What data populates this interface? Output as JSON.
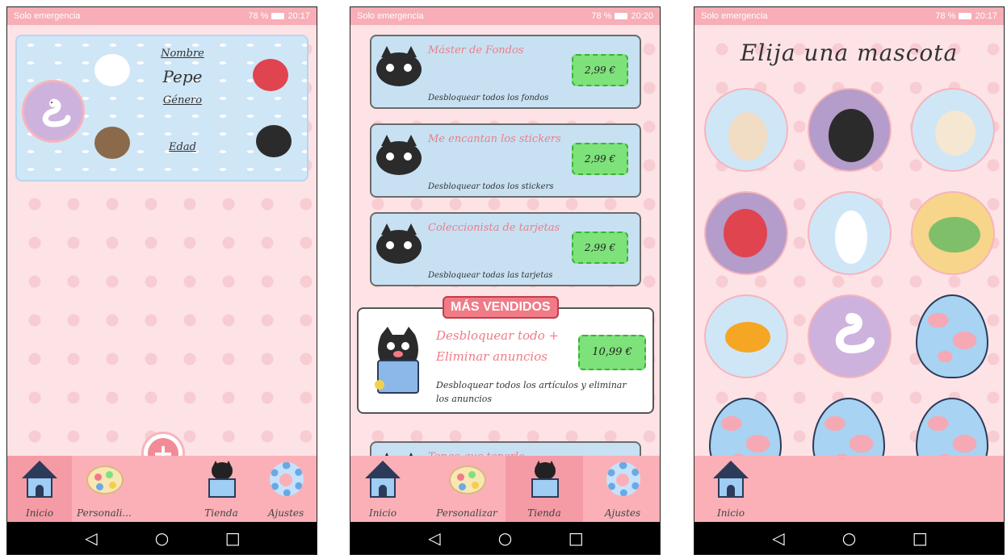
{
  "status_bar": {
    "carrier": "Solo emergencia",
    "battery": "78 %",
    "times": [
      "20:17",
      "20:20",
      "20:17"
    ]
  },
  "screen_profile": {
    "nombre_label": "Nombre",
    "nombre_value": "Pepe",
    "genero_label": "Género",
    "edad_label": "Edad",
    "tabs": [
      "Inicio",
      "Personali...",
      "Tienda",
      "Ajustes"
    ]
  },
  "screen_store": {
    "items": [
      {
        "title": "Máster de Fondos",
        "desc": "Desbloquear todos los fondos",
        "price": "2,99 €"
      },
      {
        "title": "Me encantan los stickers",
        "desc": "Desbloquear todos los stickers",
        "price": "2,99 €"
      },
      {
        "title": "Coleccionista de tarjetas",
        "desc": "Desbloquear todas las tarjetas",
        "price": "2,99 €"
      }
    ],
    "featured": {
      "badge": "MÁS VENDIDOS",
      "title": "Desbloquear todo + Eliminar anuncios",
      "desc": "Desbloquear todos los artículos y eliminar los anuncios",
      "price": "10,99 €"
    },
    "partial_item": {
      "title": "Tengo que tenerlo"
    },
    "tabs": [
      "Inicio",
      "Personalizar",
      "Tienda",
      "Ajustes"
    ]
  },
  "screen_pets": {
    "title": "Elija una mascota",
    "tabs": [
      "Inicio"
    ]
  },
  "colors": {
    "background": "#fde3e6",
    "tabbar": "#fbb0b8",
    "accent": "#f07b87",
    "price_green": "#7ee27a",
    "card_blue": "#c7e1f3"
  },
  "icons": {
    "home": "house-icon",
    "customize": "palette-icon",
    "store": "cat-box-icon",
    "settings": "gear-icon",
    "add": "plus-icon"
  }
}
